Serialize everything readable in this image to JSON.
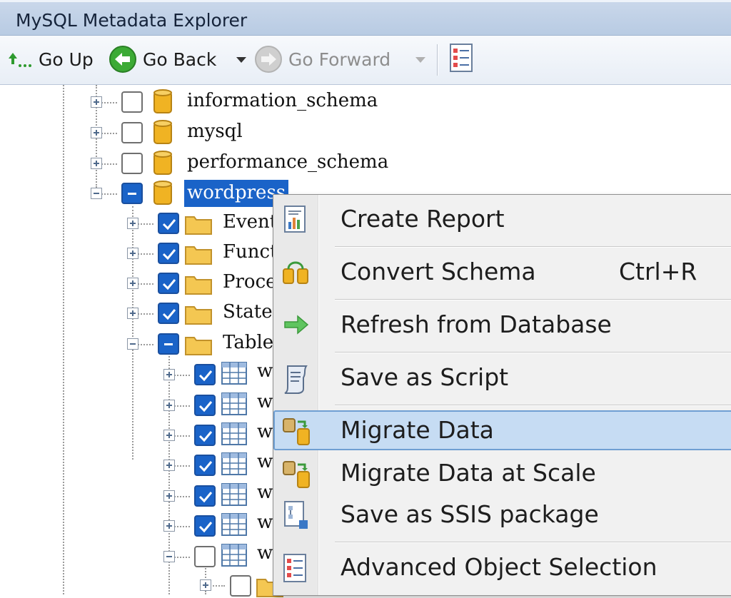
{
  "window": {
    "title": "MySQL Metadata Explorer"
  },
  "toolbar": {
    "go_up": "Go Up",
    "go_back": "Go Back",
    "go_forward": "Go Forward"
  },
  "tree": {
    "databases": [
      "information_schema",
      "mysql",
      "performance_schema",
      "wordpress"
    ],
    "folders": [
      "Event",
      "Funct",
      "Proce",
      "Staten",
      "Table"
    ],
    "table_prefix": "w"
  },
  "context_menu": {
    "items": [
      {
        "label": "Create Report",
        "icon": "report-icon"
      },
      {
        "label": "Convert Schema",
        "shortcut": "Ctrl+R",
        "icon": "convert-schema-icon"
      },
      {
        "label": "Refresh from Database",
        "icon": "refresh-arrow-icon"
      },
      {
        "label": "Save as Script",
        "icon": "script-icon"
      },
      {
        "label": "Migrate Data",
        "icon": "migrate-data-icon",
        "highlighted": true
      },
      {
        "label": "Migrate Data at Scale",
        "icon": "migrate-data-scale-icon"
      },
      {
        "label": "Save as SSIS package",
        "icon": "ssis-package-icon"
      },
      {
        "label": "Advanced Object Selection",
        "icon": "object-selection-icon"
      }
    ]
  },
  "colors": {
    "selection": "#1a63c8",
    "menu_highlight": "#c6dcf3",
    "titlebar": "#c9d7ea"
  }
}
